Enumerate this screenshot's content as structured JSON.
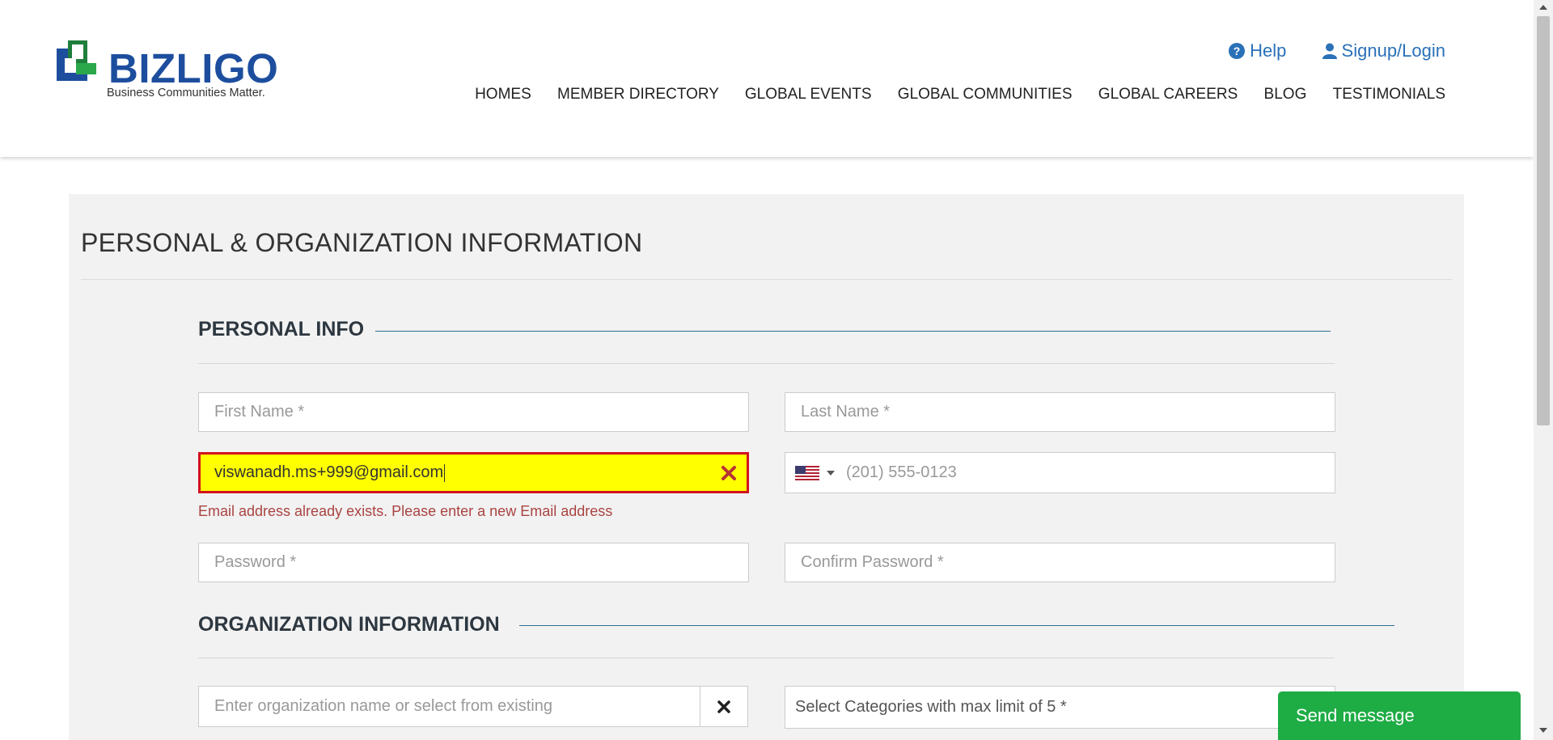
{
  "brand": {
    "name": "BIZLIGO",
    "tagline": "Business Communities Matter.",
    "logo_colors": [
      "#1e7e3c",
      "#2aa84a",
      "#1d4e9e"
    ]
  },
  "top_links": [
    {
      "icon": "question-circle-icon",
      "label": "Help"
    },
    {
      "icon": "user-icon",
      "label": "Signup/Login"
    }
  ],
  "nav": [
    "HOMES",
    "MEMBER DIRECTORY",
    "GLOBAL EVENTS",
    "GLOBAL COMMUNITIES",
    "GLOBAL CAREERS",
    "BLOG",
    "TESTIMONIALS"
  ],
  "page_title": "PERSONAL & ORGANIZATION INFORMATION",
  "personal_info": {
    "heading": "PERSONAL INFO",
    "first_name_placeholder": "First Name *",
    "last_name_placeholder": "Last Name *",
    "email_value": "viswanadh.ms+999@gmail.com",
    "email_error": "Email address already exists. Please enter a new Email address",
    "phone_placeholder": "(201) 555-0123",
    "phone_country_icon": "us-flag-icon",
    "password_placeholder": "Password *",
    "confirm_password_placeholder": "Confirm Password *"
  },
  "organization_info": {
    "heading": "ORGANIZATION INFORMATION",
    "org_name_placeholder": "Enter organization name or select from existing",
    "categories_placeholder": "Select Categories with max limit of 5 *"
  },
  "chat": {
    "label": "Send message"
  },
  "colors": {
    "link_blue": "#2a71b8",
    "error_red": "#a94442",
    "error_border": "#d2131f",
    "highlight_yellow": "#ffff00",
    "chat_green": "#1eac45",
    "panel_bg": "#f2f2f2"
  }
}
